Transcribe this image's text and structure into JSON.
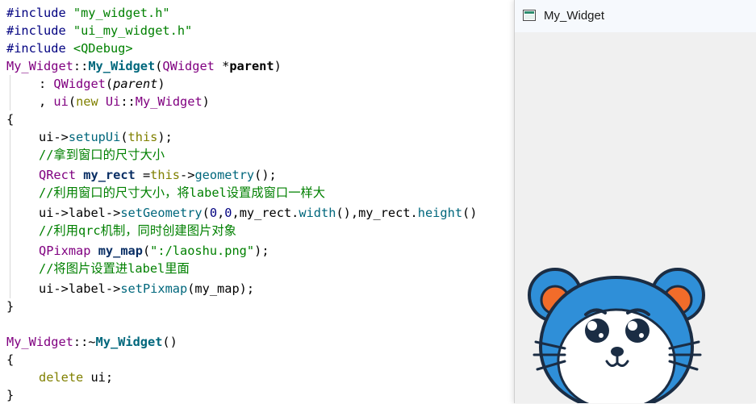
{
  "window": {
    "title": "My_Widget",
    "icon": "qt-window-icon",
    "label_image": "mouse-cartoon (laoshu.png)"
  },
  "code": {
    "l1": {
      "a": "#include ",
      "b": "\"my_widget.h\""
    },
    "l2": {
      "a": "#include ",
      "b": "\"ui_my_widget.h\""
    },
    "l3": {
      "a": "#include ",
      "b": "<QDebug>"
    },
    "l4": {
      "a": "My_Widget",
      "b": "::",
      "c": "My_Widget",
      "d": "(",
      "e": "QWidget",
      "f": " *",
      "g": "parent",
      "h": ")"
    },
    "l5": {
      "a": ": ",
      "b": "QWidget",
      "c": "(",
      "d": "parent",
      "e": ")"
    },
    "l6": {
      "a": ", ",
      "b": "ui",
      "c": "(",
      "d": "new",
      "e": " ",
      "f": "Ui",
      "g": "::",
      "h": "My_Widget",
      "i": ")"
    },
    "l7": {
      "a": "{"
    },
    "l8": {
      "a": "ui->",
      "b": "setupUi",
      "c": "(",
      "d": "this",
      "e": ");"
    },
    "l9": {
      "a": "//拿到窗口的尺寸大小"
    },
    "l10": {
      "a": "QRect",
      "b": " ",
      "c": "my_rect",
      "d": " =",
      "e": "this",
      "f": "->",
      "g": "geometry",
      "h": "();"
    },
    "l11": {
      "a": "//利用窗口的尺寸大小，将label设置成窗口一样大"
    },
    "l12": {
      "a": "ui->label->",
      "b": "setGeometry",
      "c": "(",
      "d": "0",
      "e": ",",
      "f": "0",
      "g": ",my_rect.",
      "h": "width",
      "i": "(),my_rect.",
      "j": "height",
      "k": "()"
    },
    "l13": {
      "a": "//利用qrc机制，同时创建图片对象"
    },
    "l14": {
      "a": "QPixmap",
      "b": " ",
      "c": "my_map",
      "d": "(",
      "e": "\":/laoshu.png\"",
      "f": ");"
    },
    "l15": {
      "a": "//将图片设置进label里面"
    },
    "l16": {
      "a": "ui->label->",
      "b": "setPixmap",
      "c": "(my_map);"
    },
    "l17": {
      "a": "}"
    },
    "l18": {
      "a": "My_Widget",
      "b": "::~",
      "c": "My_Widget",
      "d": "()"
    },
    "l19": {
      "a": "{"
    },
    "l20": {
      "a": "delete",
      "b": " ui;"
    },
    "l21": {
      "a": "}"
    }
  },
  "colors": {
    "preprocessor": "#000080",
    "string": "#008000",
    "class": "#800080",
    "function": "#00677c",
    "keyword": "#808000",
    "comment": "#008000",
    "variable": "#092e64"
  }
}
